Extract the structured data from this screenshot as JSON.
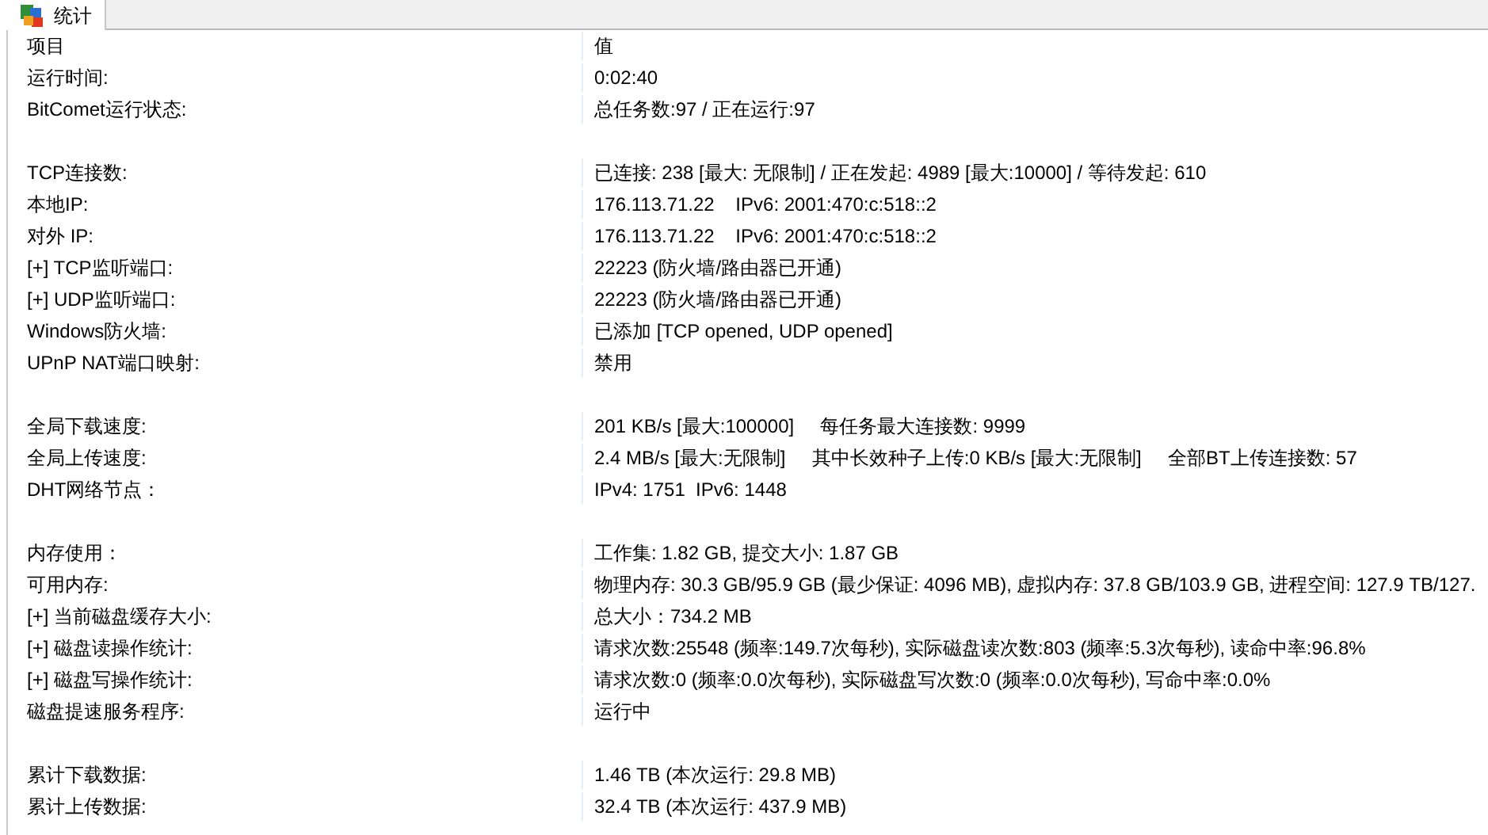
{
  "tabs": [
    {
      "label": "统计",
      "selected": true
    }
  ],
  "table": {
    "columns": [
      "项目",
      "值"
    ],
    "rows": [
      {
        "kind": "data",
        "item": "运行时间:",
        "value": "0:02:40"
      },
      {
        "kind": "data",
        "item": "BitComet运行状态:",
        "value": "总任务数:97 / 正在运行:97"
      },
      {
        "kind": "spacer"
      },
      {
        "kind": "data",
        "item": "TCP连接数:",
        "value": "已连接: 238 [最大: 无限制] / 正在发起: 4989 [最大:10000] / 等待发起: 610"
      },
      {
        "kind": "data",
        "item": "本地IP:",
        "value": "176.113.71.22    IPv6: 2001:470:c:518::2"
      },
      {
        "kind": "data",
        "item": "对外 IP:",
        "value": "176.113.71.22    IPv6: 2001:470:c:518::2"
      },
      {
        "kind": "data",
        "item": "[+] TCP监听端口:",
        "value": "22223 (防火墙/路由器已开通)"
      },
      {
        "kind": "data",
        "item": "[+] UDP监听端口:",
        "value": "22223 (防火墙/路由器已开通)"
      },
      {
        "kind": "data",
        "item": "Windows防火墙:",
        "value": "已添加 [TCP opened, UDP opened]"
      },
      {
        "kind": "data",
        "item": "UPnP NAT端口映射:",
        "value": "禁用"
      },
      {
        "kind": "spacer"
      },
      {
        "kind": "data",
        "item": "全局下载速度:",
        "value": "201 KB/s [最大:100000]     每任务最大连接数: 9999"
      },
      {
        "kind": "data",
        "item": "全局上传速度:",
        "value": "2.4 MB/s [最大:无限制]     其中长效种子上传:0 KB/s [最大:无限制]     全部BT上传连接数: 57"
      },
      {
        "kind": "data",
        "item": "DHT网络节点：",
        "value": "IPv4: 1751  IPv6: 1448"
      },
      {
        "kind": "spacer"
      },
      {
        "kind": "data",
        "item": "内存使用：",
        "value": "工作集: 1.82 GB, 提交大小: 1.87 GB"
      },
      {
        "kind": "data",
        "item": "可用内存:",
        "value": "物理内存: 30.3 GB/95.9 GB (最少保证: 4096 MB), 虚拟内存: 37.8 GB/103.9 GB, 进程空间: 127.9 TB/127."
      },
      {
        "kind": "data",
        "item": "[+] 当前磁盘缓存大小:",
        "value": "总大小：734.2 MB"
      },
      {
        "kind": "data",
        "item": "[+] 磁盘读操作统计:",
        "value": "请求次数:25548 (频率:149.7次每秒), 实际磁盘读次数:803 (频率:5.3次每秒), 读命中率:96.8%"
      },
      {
        "kind": "data",
        "item": "[+] 磁盘写操作统计:",
        "value": "请求次数:0 (频率:0.0次每秒), 实际磁盘写次数:0 (频率:0.0次每秒), 写命中率:0.0%"
      },
      {
        "kind": "data",
        "item": "磁盘提速服务程序:",
        "value": "运行中"
      },
      {
        "kind": "spacer"
      },
      {
        "kind": "data",
        "item": "累计下载数据:",
        "value": "1.46 TB (本次运行: 29.8 MB)"
      },
      {
        "kind": "data",
        "item": "累计上传数据:",
        "value": "32.4 TB (本次运行: 437.9 MB)"
      }
    ]
  }
}
